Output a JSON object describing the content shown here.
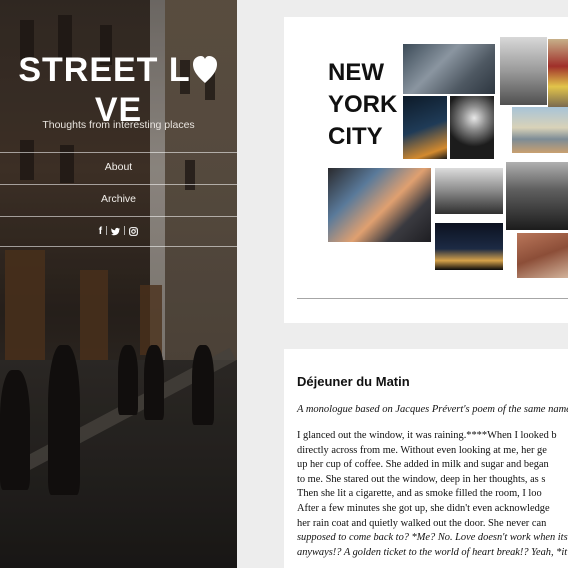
{
  "sidebar": {
    "logo_left": "STREET L",
    "logo_right": "VE",
    "tagline": "Thoughts from interesting places",
    "nav": [
      {
        "label": "About"
      },
      {
        "label": "Archive"
      }
    ],
    "social": [
      {
        "icon": "facebook-icon",
        "glyph": "f"
      },
      {
        "icon": "twitter-icon"
      },
      {
        "icon": "instagram-icon"
      }
    ],
    "separator": "|"
  },
  "collage": {
    "title_lines": [
      "NEW",
      "YORK",
      "CITY"
    ]
  },
  "post": {
    "title": "Déjeuner du Matin",
    "subtitle": "A monologue based on Jacques Prévert's poem of the same name",
    "body_lines": [
      "I glanced out the window, it was raining.****When I looked b",
      "directly across from me. Without even looking at me, her ge",
      "up her cup of coffee. She added in milk and sugar and began",
      "to me. She stared out the window, deep in her thoughts, as s",
      "Then she lit a cigarette, and as smoke filled the room, I loo",
      "After a few minutes she got up, she didn't even acknowledge",
      "her rain coat and quietly walked out the door. She never can"
    ],
    "body_italic_lines": [
      "supposed to come back to? *Me? No. Love doesn't work when its",
      "anyways!? A golden ticket to the world of heart break!? Yeah, *it is."
    ]
  },
  "colors": {
    "page_bg": "#ededed",
    "card_bg": "#ffffff",
    "text": "#111111",
    "sidebar_text": "#ffffff"
  }
}
